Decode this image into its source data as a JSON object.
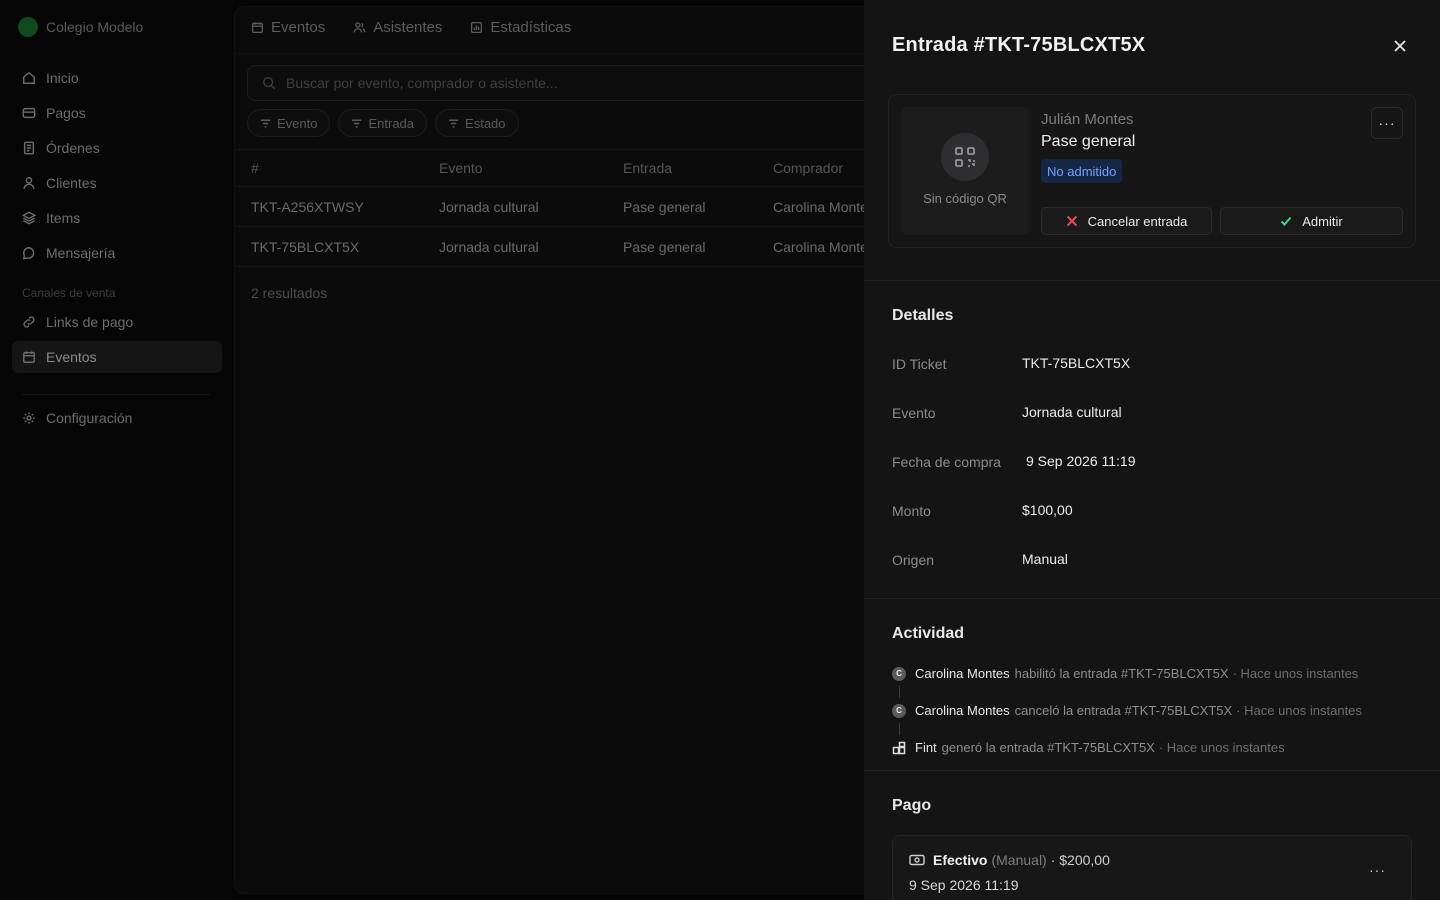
{
  "sidebar": {
    "brand": "Colegio Modelo",
    "items": [
      {
        "label": "Inicio",
        "icon": "home-icon"
      },
      {
        "label": "Pagos",
        "icon": "card-icon"
      },
      {
        "label": "Órdenes",
        "icon": "receipt-icon"
      },
      {
        "label": "Clientes",
        "icon": "user-icon"
      },
      {
        "label": "Items",
        "icon": "layers-icon"
      },
      {
        "label": "Mensajería",
        "icon": "chat-icon"
      }
    ],
    "section_label": "Canales de venta",
    "channel_items": [
      {
        "label": "Links de pago",
        "icon": "link-icon"
      },
      {
        "label": "Eventos",
        "icon": "calendar-icon",
        "active": true
      }
    ],
    "settings_label": "Configuración"
  },
  "main": {
    "tabs": [
      {
        "label": "Eventos"
      },
      {
        "label": "Asistentes"
      },
      {
        "label": "Estadísticas"
      }
    ],
    "search_placeholder": "Buscar por evento, comprador o asistente...",
    "filters": [
      "Evento",
      "Entrada",
      "Estado"
    ],
    "columns": [
      "#",
      "Evento",
      "Entrada",
      "Comprador"
    ],
    "rows": [
      [
        "TKT-A256XTWSY",
        "Jornada cultural",
        "Pase general",
        "Carolina Montes"
      ],
      [
        "TKT-75BLCXT5X",
        "Jornada cultural",
        "Pase general",
        "Carolina Montes"
      ]
    ],
    "results_text": "2 resultados"
  },
  "drawer": {
    "title": "Entrada #TKT-75BLCXT5X",
    "ticket": {
      "qr_label": "Sin código QR",
      "holder": "Julián Montes",
      "pass": "Pase general",
      "status": "No admitido",
      "more": "···",
      "cancel_label": "Cancelar entrada",
      "admit_label": "Admitir"
    },
    "details_title": "Detalles",
    "details": [
      {
        "label": "ID Ticket",
        "value": "TKT-75BLCXT5X"
      },
      {
        "label": "Evento",
        "value": "Jornada cultural"
      },
      {
        "label": "Fecha de compra",
        "value": "9 Sep 2026 11:19"
      },
      {
        "label": "Monto",
        "value": "$100,00"
      },
      {
        "label": "Origen",
        "value": "Manual"
      }
    ],
    "activity_title": "Actividad",
    "activity": [
      {
        "initial": "C",
        "actor": "Carolina Montes",
        "text": "habilitó la entrada #TKT-75BLCXT5X",
        "time": "· Hace unos instantes"
      },
      {
        "initial": "C",
        "actor": "Carolina Montes",
        "text": "canceló la entrada #TKT-75BLCXT5X",
        "time": "· Hace unos instantes"
      },
      {
        "initial": "",
        "actor": "Fint",
        "text": "generó la entrada #TKT-75BLCXT5X",
        "time": "· Hace unos instantes"
      }
    ],
    "payment_title": "Pago",
    "payment": {
      "method": "Efectivo",
      "kind": "(Manual)",
      "amount": "· $200,00",
      "date": "9 Sep 2026 11:19",
      "more": "···"
    }
  },
  "colors": {
    "accent_green": "#3dd68c",
    "danger_red": "#e5484d",
    "badge_blue": "#6ea3ff"
  }
}
